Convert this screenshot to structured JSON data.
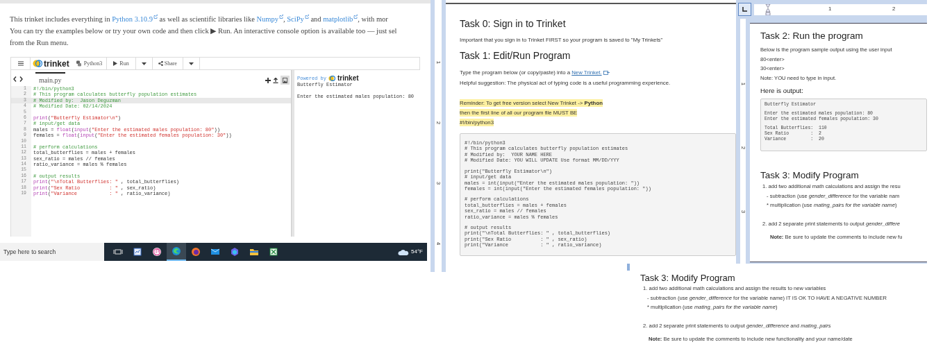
{
  "trinket_page": {
    "intro_lines": [
      [
        {
          "kind": "text",
          "text": "This trinket includes everything in "
        },
        {
          "kind": "link",
          "text": "Python 3.10.9"
        },
        {
          "kind": "text",
          "text": " as well as scientific libraries like "
        },
        {
          "kind": "link",
          "text": "Numpy"
        },
        {
          "kind": "text",
          "text": ", "
        },
        {
          "kind": "link",
          "text": "SciPy"
        },
        {
          "kind": "text",
          "text": " and "
        },
        {
          "kind": "link",
          "text": "matplotlib"
        },
        {
          "kind": "text",
          "text": ", with mor"
        }
      ],
      [
        {
          "kind": "text",
          "text": "You can try the examples below or try your own code and then click ▶ Run. An interactive console option is available too — just sel"
        }
      ],
      [
        {
          "kind": "text",
          "text": "from the Run menu."
        }
      ]
    ],
    "toolbar": {
      "logo": "trinket",
      "language": "Python3",
      "run": "Run",
      "share": "Share"
    },
    "editor": {
      "file_tab": "main.py",
      "lines": [
        {
          "number": "1",
          "current": false,
          "tokens": [
            {
              "kind": "comment",
              "text": "#!/bin/python3"
            }
          ]
        },
        {
          "number": "2",
          "current": false,
          "tokens": [
            {
              "kind": "comment",
              "text": "# This program calculates butterfly population estimates"
            }
          ]
        },
        {
          "number": "3",
          "current": true,
          "tokens": [
            {
              "kind": "comment",
              "text": "# Modified by:  Jason Deguzman"
            }
          ]
        },
        {
          "number": "4",
          "current": false,
          "tokens": [
            {
              "kind": "comment",
              "text": "# Modified Date: 02/14/2024"
            }
          ]
        },
        {
          "number": "5",
          "current": false
        },
        {
          "number": "6",
          "current": false,
          "tokens": [
            {
              "kind": "builtin",
              "text": "print"
            },
            {
              "kind": "plain",
              "text": "("
            },
            {
              "kind": "string",
              "text": "\"Butterfly Estimator\\n\""
            },
            {
              "kind": "plain",
              "text": ")"
            }
          ]
        },
        {
          "number": "7",
          "current": false,
          "tokens": [
            {
              "kind": "comment",
              "text": "# input/get data"
            }
          ]
        },
        {
          "number": "8",
          "current": false,
          "tokens": [
            {
              "kind": "plain",
              "text": "males = "
            },
            {
              "kind": "builtin",
              "text": "float"
            },
            {
              "kind": "plain",
              "text": "("
            },
            {
              "kind": "builtin",
              "text": "input"
            },
            {
              "kind": "plain",
              "text": "("
            },
            {
              "kind": "string",
              "text": "\"Enter the estimated males population: 80\""
            },
            {
              "kind": "plain",
              "text": "))"
            }
          ]
        },
        {
          "number": "9",
          "current": false,
          "tokens": [
            {
              "kind": "plain",
              "text": "females = "
            },
            {
              "kind": "builtin",
              "text": "float"
            },
            {
              "kind": "plain",
              "text": "("
            },
            {
              "kind": "builtin",
              "text": "input"
            },
            {
              "kind": "plain",
              "text": "("
            },
            {
              "kind": "string",
              "text": "\"Enter the estimated females population: 30\""
            },
            {
              "kind": "plain",
              "text": "))"
            }
          ]
        },
        {
          "number": "10",
          "current": false
        },
        {
          "number": "11",
          "current": false,
          "tokens": [
            {
              "kind": "comment",
              "text": "# perform calculations"
            }
          ]
        },
        {
          "number": "12",
          "current": false,
          "tokens": [
            {
              "kind": "plain",
              "text": "total_butterflies = males + females"
            }
          ]
        },
        {
          "number": "13",
          "current": false,
          "tokens": [
            {
              "kind": "plain",
              "text": "sex_ratio = males // females"
            }
          ]
        },
        {
          "number": "14",
          "current": false,
          "tokens": [
            {
              "kind": "plain",
              "text": "ratio_variance = males % females"
            }
          ]
        },
        {
          "number": "15",
          "current": false
        },
        {
          "number": "16",
          "current": false,
          "tokens": [
            {
              "kind": "comment",
              "text": "# output results"
            }
          ]
        },
        {
          "number": "17",
          "current": false,
          "tokens": [
            {
              "kind": "builtin",
              "text": "print"
            },
            {
              "kind": "plain",
              "text": "("
            },
            {
              "kind": "string",
              "text": "\"\\nTotal Butterflies: \""
            },
            {
              "kind": "plain",
              "text": " , total_butterflies)"
            }
          ]
        },
        {
          "number": "18",
          "current": false,
          "tokens": [
            {
              "kind": "builtin",
              "text": "print"
            },
            {
              "kind": "plain",
              "text": "("
            },
            {
              "kind": "string",
              "text": "\"Sex Ratio          : \""
            },
            {
              "kind": "plain",
              "text": " , sex_ratio)"
            }
          ]
        },
        {
          "number": "19",
          "current": false,
          "tokens": [
            {
              "kind": "builtin",
              "text": "print"
            },
            {
              "kind": "plain",
              "text": "("
            },
            {
              "kind": "string",
              "text": "\"Variance           : \""
            },
            {
              "kind": "plain",
              "text": " , ratio_variance)"
            }
          ]
        }
      ]
    },
    "output": {
      "powered_by": "Powered by",
      "logo": "trinket",
      "groups": [
        [
          "Butterfly Estimator"
        ],
        [
          "Enter the estimated males population: 80"
        ]
      ]
    }
  },
  "taskbar": {
    "search_placeholder": "Type here to search",
    "apps": [
      {
        "kind": "task-view",
        "selected": false
      },
      {
        "kind": "document",
        "selected": false
      },
      {
        "kind": "music",
        "selected": false
      },
      {
        "kind": "browser",
        "selected": true
      },
      {
        "kind": "fox-browser",
        "selected": false
      },
      {
        "kind": "mail",
        "selected": false
      },
      {
        "kind": "hexagon",
        "selected": false
      },
      {
        "kind": "folder",
        "selected": false
      },
      {
        "kind": "sheet",
        "selected": false
      }
    ],
    "weather": "54°F"
  },
  "doc_middle": {
    "ruler_labels": [
      "1",
      "2",
      "3",
      "4"
    ],
    "task0": {
      "heading": "Task 0: Sign in to Trinket",
      "text": "Important that you sign in to Trinket FIRST so your program is saved to \"My Trinkets\""
    },
    "task1": {
      "heading": "Task 1: Edit/Run Program",
      "intro": "Type the program below (or copy/paste) into a ",
      "link": "New Trinket.",
      "suggestion": "Helpful suggestion: The physical act of typing code is a useful programming experience.",
      "reminder": [
        "Reminder: To get free version select New Trinket -> **Python**",
        "then the first line of all our program file MUST BE",
        "#!/bin/python3"
      ],
      "code_groups": [
        [
          "#!/bin/python3",
          "# This program calculates butterfly population estimates",
          "# Modified by:  YOUR NAME HERE",
          "# Modified Date: YOU WILL UPDATE Use format MM/DD/YYY"
        ],
        [
          "print(\"Butterfly Estimator\\n\")",
          "# input/get data",
          "males = int(input(\"Enter the estimated males population: \"))",
          "females = int(input(\"Enter the estimated females population: \"))"
        ],
        [
          "# perform calculations",
          "total_butterflies = males + females",
          "sex_ratio = males // females",
          "ratio_variance = males % females"
        ],
        [
          "# output results",
          "print(\"\\nTotal Butterflies: \" , total_butterflies)",
          "print(\"Sex Ratio          : \" , sex_ratio)",
          "print(\"Variance           : \" , ratio_variance)"
        ]
      ]
    }
  },
  "doc_right": {
    "top_ruler_labels": [
      "1",
      "2"
    ],
    "ruler_labels": [
      "1",
      "2",
      "3"
    ],
    "task2": {
      "heading": "Task 2: Run the program",
      "lines": [
        "Below is the program sample output using the user input",
        "80<enter>",
        "30<enter>",
        "Note: YOU need to type in input."
      ],
      "output_heading": "Here is output:",
      "output_groups": [
        [
          "Butterfly Estimator"
        ],
        [
          "Enter the estimated males population: 80",
          "Enter the estimated females population: 30"
        ],
        [
          "Total Butterflies:  110",
          "Sex Ratio        :  2",
          "Variance         :  20"
        ]
      ]
    },
    "task3": {
      "heading": "Task 3: Modify Program",
      "groups": [
        [
          {
            "kind": "numbered",
            "text": "1. add two additional math calculations and assign the resu"
          },
          {
            "kind": "sub",
            "text": "- subtraction (use *gender_difference* for the variable nam"
          },
          {
            "kind": "sub",
            "text": "* multiplication (use *mating_pairs for the variable name*)"
          }
        ],
        [
          {
            "kind": "numbered",
            "text": "2. add 2 separate print statements to output *gender_differe*"
          },
          {
            "kind": "note",
            "text": "**Note:** Be sure to update the comments to include new fu"
          }
        ]
      ]
    }
  },
  "doc_bottom": {
    "task3": {
      "heading": "Task 3: Modify Program",
      "groups": [
        [
          {
            "kind": "numbered",
            "text": "1. add two additional math calculations and assign the results to new variables"
          },
          {
            "kind": "sub",
            "text": "- subtraction (use *gender_difference* for the variable name) IT IS OK TO HAVE A NEGATIVE NUMBER"
          },
          {
            "kind": "sub",
            "text": "* multiplication (use *mating_pairs for the variable name*)"
          }
        ],
        [
          {
            "kind": "numbered",
            "text": "2. add 2 separate print statements to output *gender_difference* and *mating_pairs*"
          },
          {
            "kind": "note",
            "text": "**Note:** Be sure to update the comments to include new functionality and your name/date"
          }
        ]
      ]
    }
  }
}
